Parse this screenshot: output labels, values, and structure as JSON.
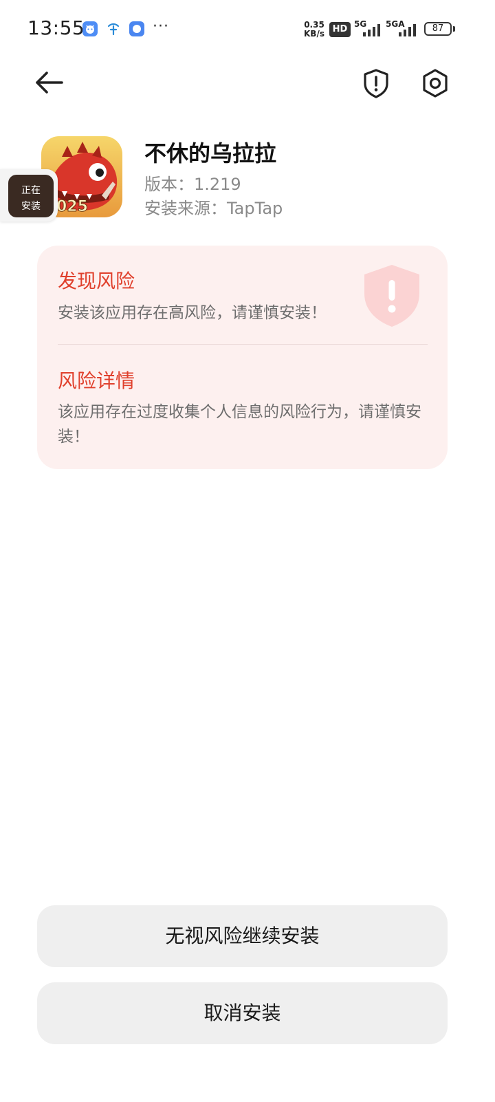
{
  "status_bar": {
    "time": "13:55",
    "more": "···",
    "net_speed_value": "0.35",
    "net_speed_unit": "KB/s",
    "hd_badge": "HD",
    "sim1_label": "5G",
    "sim2_label": "5GA",
    "battery": "87"
  },
  "toolbar": {
    "back_icon": "arrow-left-icon",
    "shield_icon": "shield-exclamation-icon",
    "settings_icon": "gear-icon"
  },
  "app": {
    "name": "不休的乌拉拉",
    "version": "版本：1.219",
    "source": "安装来源：TapTap",
    "icon_badge_text": "025",
    "installing_line1": "正在",
    "installing_line2": "安装"
  },
  "risk": {
    "found_title": "发现风险",
    "found_desc": "安装该应用存在高风险，请谨慎安装！",
    "details_title": "风险详情",
    "details_desc": "该应用存在过度收集个人信息的风险行为，请谨慎安装！",
    "accent_color": "#e0402c",
    "card_color": "#fdf0ef"
  },
  "actions": {
    "continue_label": "无视风险继续安装",
    "cancel_label": "取消安装"
  }
}
